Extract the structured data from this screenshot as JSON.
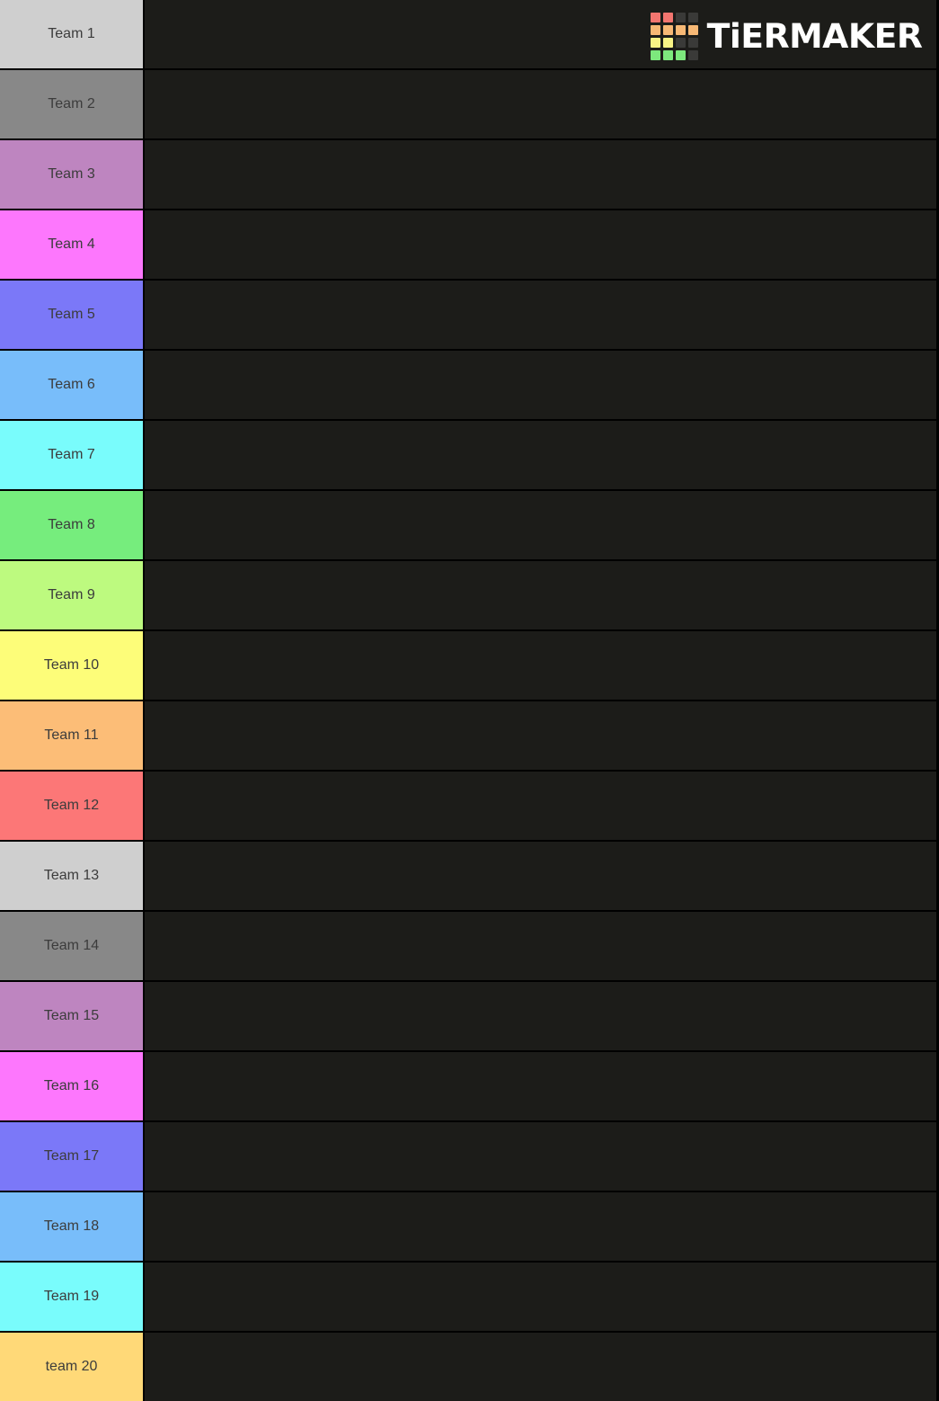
{
  "app": {
    "name": "TierMaker",
    "wordmark": "TiERMAKER",
    "background_color": "#000000",
    "drop_zone_color": "#1c1c19",
    "label_text_color": "#3c3c3c"
  },
  "logo": {
    "alt": "TierMaker logo",
    "grid_colors": [
      [
        "#f2756f",
        "#f2756f",
        "#3a3a38",
        "#3a3a38"
      ],
      [
        "#f7b875",
        "#f7b875",
        "#f7b875",
        "#f7b875"
      ],
      [
        "#f8f285",
        "#f8f285",
        "#3a3a38",
        "#3a3a38"
      ],
      [
        "#7de87d",
        "#7de87d",
        "#7de87d",
        "#3a3a38"
      ]
    ]
  },
  "tiers": [
    {
      "label": "Team 1",
      "color": "#cfcfcf"
    },
    {
      "label": "Team 2",
      "color": "#888888"
    },
    {
      "label": "Team 3",
      "color": "#be85c0"
    },
    {
      "label": "Team 4",
      "color": "#fd77fd"
    },
    {
      "label": "Team 5",
      "color": "#7b78f8"
    },
    {
      "label": "Team 6",
      "color": "#78bdfa"
    },
    {
      "label": "Team 7",
      "color": "#79fcfc"
    },
    {
      "label": "Team 8",
      "color": "#76ed7d"
    },
    {
      "label": "Team 9",
      "color": "#bdfa7f"
    },
    {
      "label": "Team 10",
      "color": "#fdfd79"
    },
    {
      "label": "Team 11",
      "color": "#fcbd77"
    },
    {
      "label": "Team 12",
      "color": "#fc7777"
    },
    {
      "label": "Team 13",
      "color": "#cfcfcf"
    },
    {
      "label": "Team 14",
      "color": "#888888"
    },
    {
      "label": "Team 15",
      "color": "#be85c0"
    },
    {
      "label": "Team 16",
      "color": "#fd77fd"
    },
    {
      "label": "Team 17",
      "color": "#7b78f8"
    },
    {
      "label": "Team 18",
      "color": "#78bdfa"
    },
    {
      "label": "Team 19",
      "color": "#79fcfc"
    },
    {
      "label": "team 20",
      "color": "#ffd978"
    }
  ]
}
